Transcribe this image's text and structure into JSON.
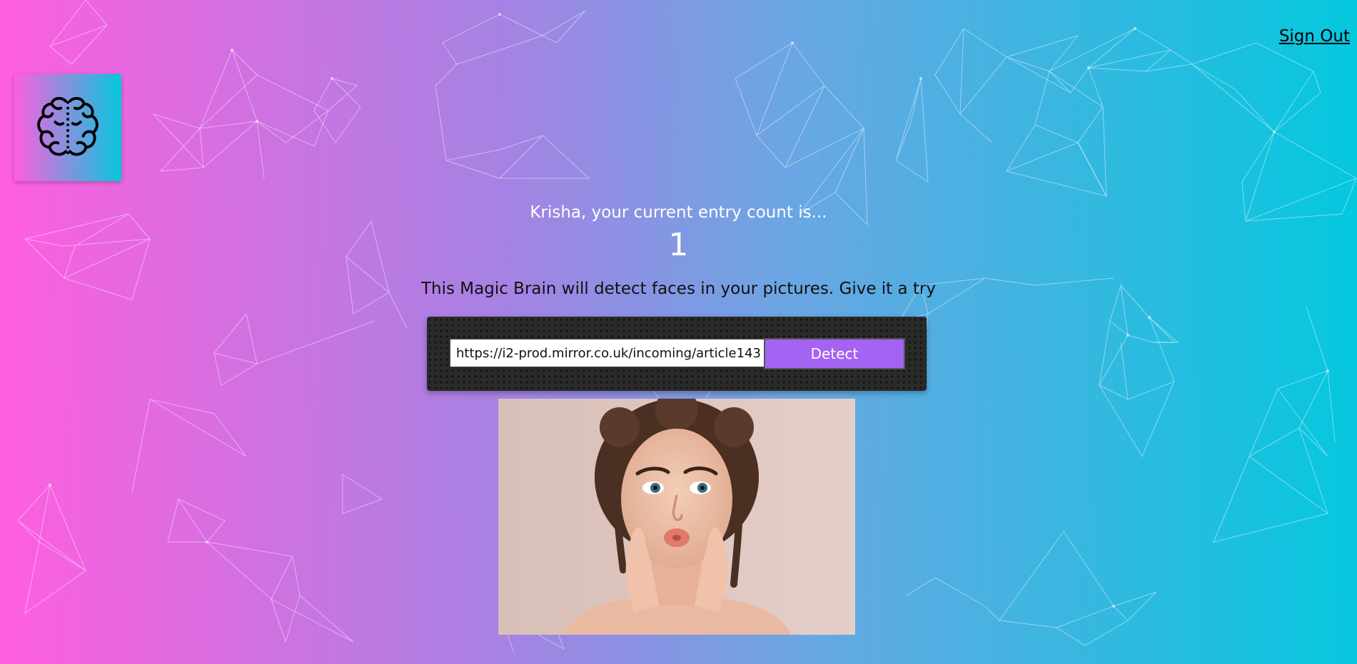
{
  "nav": {
    "signout_label": "Sign Out"
  },
  "logo": {
    "icon": "brain-icon"
  },
  "rank": {
    "message": "Krisha, your current entry count is...",
    "count": "1"
  },
  "form": {
    "tagline": "This Magic Brain will detect faces in your pictures. Give it a try",
    "input_value": "https://i2-prod.mirror.co.uk/incoming/article143",
    "button_label": "Detect"
  },
  "image": {
    "subject": "face-photo"
  },
  "colors": {
    "gradient_start": "#ff5edf",
    "gradient_end": "#04c8de",
    "button": "#a463f2"
  }
}
